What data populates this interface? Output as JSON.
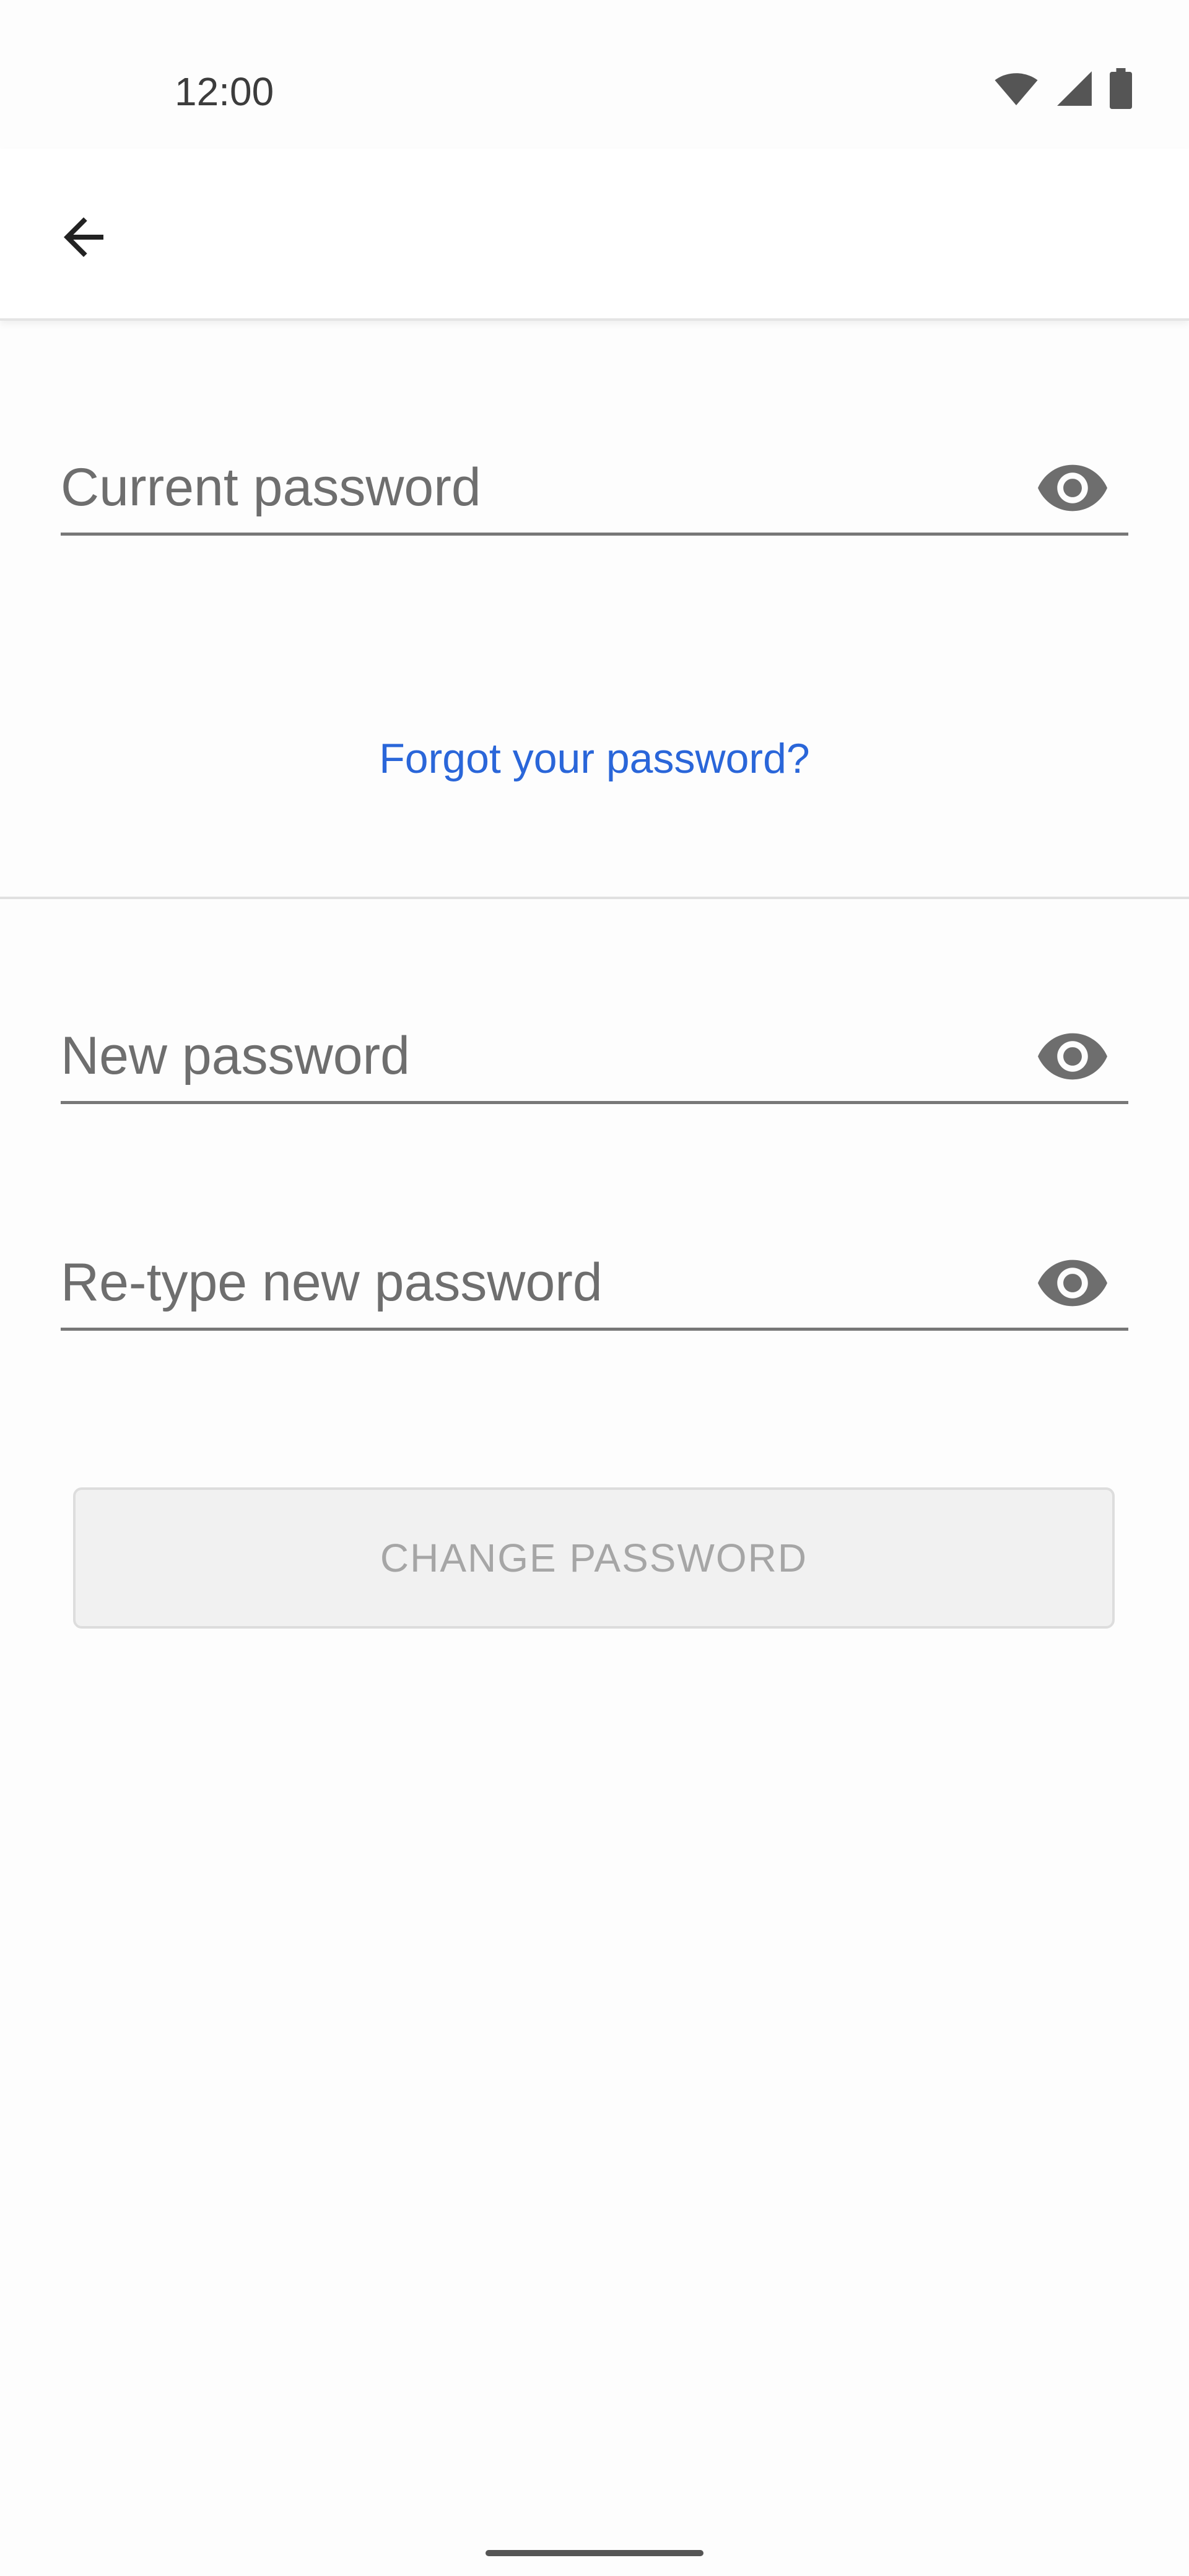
{
  "status_bar": {
    "time": "12:00",
    "icons": [
      "wifi-icon",
      "signal-icon",
      "battery-icon"
    ]
  },
  "app_bar": {
    "back_icon": "arrow-back-icon"
  },
  "form": {
    "current_password": {
      "placeholder": "Current password",
      "value": "",
      "toggle_icon": "eye-icon"
    },
    "forgot_link": "Forgot your password?",
    "new_password": {
      "placeholder": "New password",
      "value": "",
      "toggle_icon": "eye-icon"
    },
    "retype_password": {
      "placeholder": "Re-type new password",
      "value": "",
      "toggle_icon": "eye-icon"
    },
    "submit_label": "CHANGE PASSWORD",
    "submit_enabled": false
  },
  "colors": {
    "link": "#2a66d9",
    "icon": "#6e6e6e",
    "disabled_text": "#a6a6a6",
    "disabled_bg": "#f1f1f1"
  }
}
